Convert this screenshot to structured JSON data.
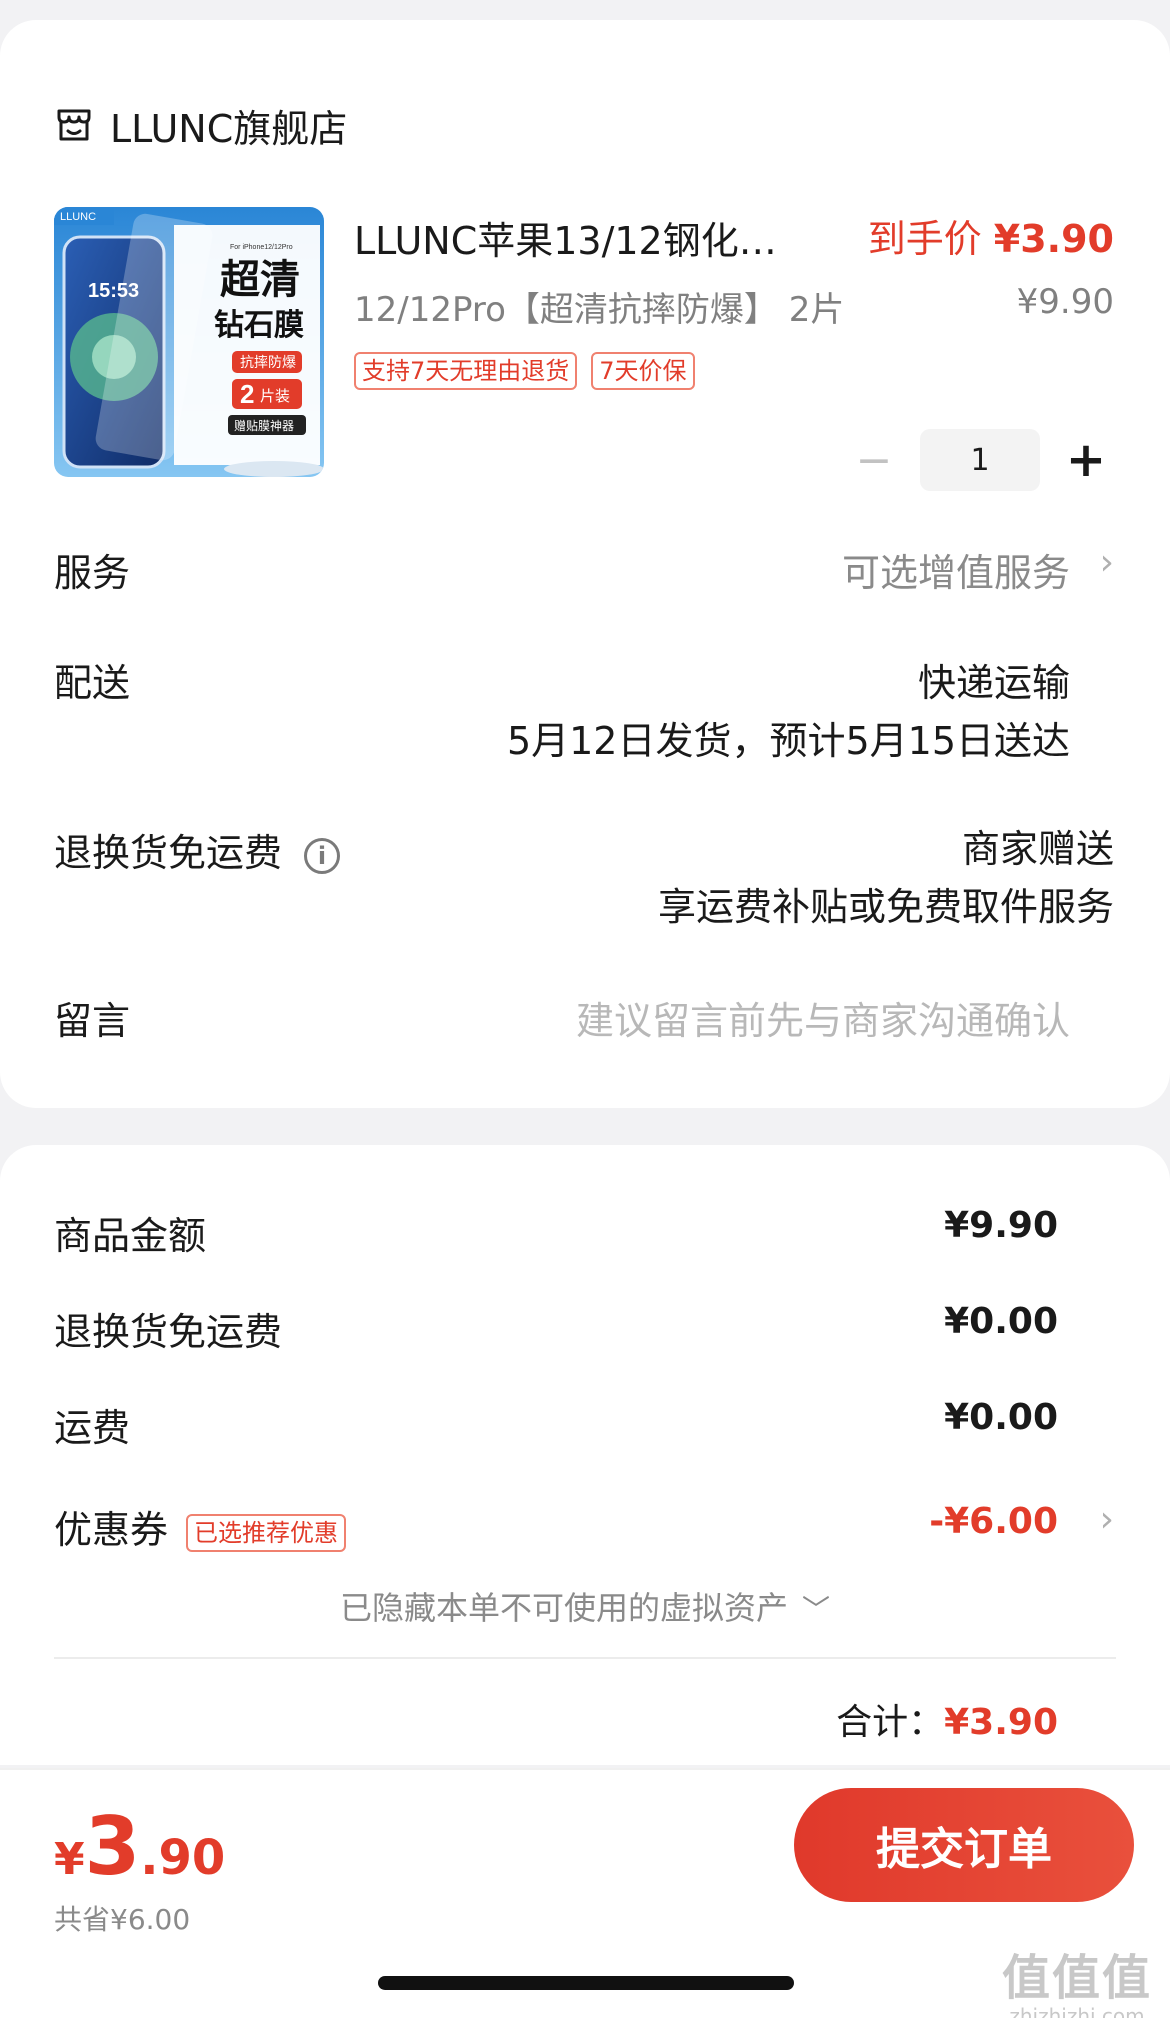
{
  "store": {
    "name": "LLUNC旗舰店",
    "icon": "store-icon"
  },
  "product": {
    "title": "LLUNC苹果13/12钢化…",
    "final_price_label": "到手价",
    "final_price": "¥3.90",
    "spec": "12/12Pro【超清抗摔防爆】 2片",
    "original_price": "¥9.90",
    "tags": [
      "支持7天无理由退货",
      "7天价保"
    ],
    "quantity": "1",
    "image": {
      "brand": "LLUNC",
      "subtitle": "For iPhone12/12Pro",
      "time": "15:53",
      "headline1": "超清",
      "headline2": "钻石膜",
      "badge1": "抗摔防爆",
      "badge2_num": "2",
      "badge2_text": "片装",
      "badge3": "赠贴膜神器"
    }
  },
  "service": {
    "label": "服务",
    "value": "可选增值服务"
  },
  "delivery": {
    "label": "配送",
    "method": "快递运输",
    "eta": "5月12日发货，预计5月15日送达"
  },
  "return_shipping": {
    "label": "退换货免运费",
    "value": "商家赠送",
    "desc": "享运费补贴或免费取件服务"
  },
  "message": {
    "label": "留言",
    "placeholder": "建议留言前先与商家沟通确认"
  },
  "summary": {
    "goods_label": "商品金额",
    "goods_value": "¥9.90",
    "return_label": "退换货免运费",
    "return_value": "¥0.00",
    "shipping_label": "运费",
    "shipping_value": "¥0.00",
    "coupon_label": "优惠券",
    "coupon_tag": "已选推荐优惠",
    "coupon_value": "-¥6.00",
    "hidden_note": "已隐藏本单不可使用的虚拟资产",
    "total_label": "合计：",
    "total_value": "¥3.90"
  },
  "bottom": {
    "yen": "¥",
    "price_int": "3",
    "price_dec": ".90",
    "saved": "共省¥6.00",
    "submit": "提交订单"
  },
  "watermark": {
    "big": "值值值",
    "small": "zhizhizhi.com"
  },
  "colors": {
    "accent": "#e23c2a",
    "background": "#f2f2f4"
  }
}
